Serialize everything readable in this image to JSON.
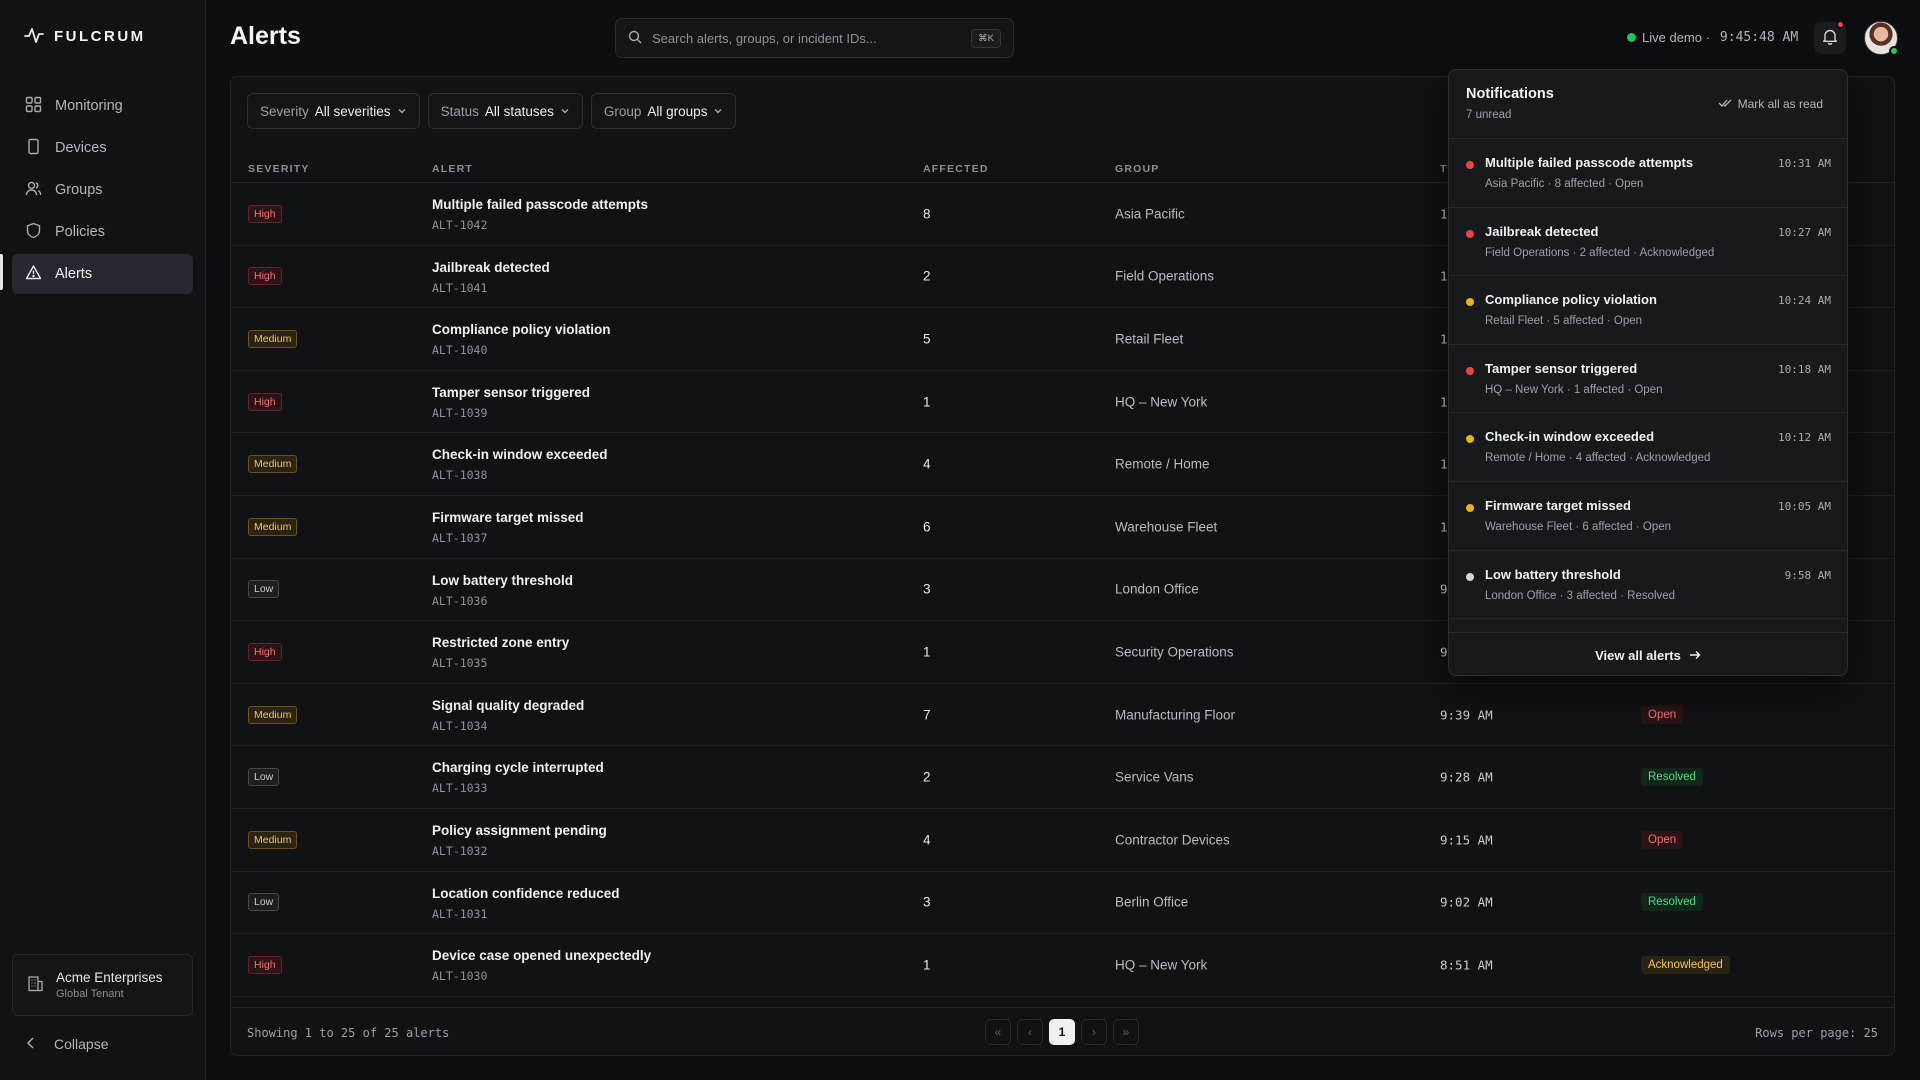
{
  "brand": "FULCRUM",
  "page_title": "Alerts",
  "sidebar": {
    "items": [
      {
        "label": "Monitoring",
        "icon": "grid-icon"
      },
      {
        "label": "Devices",
        "icon": "device-icon"
      },
      {
        "label": "Groups",
        "icon": "users-icon"
      },
      {
        "label": "Policies",
        "icon": "shield-icon"
      },
      {
        "label": "Alerts",
        "icon": "alert-triangle-icon",
        "active": true
      }
    ],
    "tenant": {
      "name": "Acme Enterprises",
      "sub": "Global Tenant"
    },
    "collapse_label": "Collapse"
  },
  "search": {
    "placeholder": "Search alerts, groups, or incident IDs...",
    "shortcut": "⌘K"
  },
  "header": {
    "live_label": "Live demo ·",
    "clock": "9:45:48 AM"
  },
  "filters": [
    {
      "label": "Severity",
      "value": "All severities"
    },
    {
      "label": "Status",
      "value": "All statuses"
    },
    {
      "label": "Group",
      "value": "All groups"
    }
  ],
  "table": {
    "columns": [
      "Severity",
      "Alert",
      "Affected",
      "Group",
      "T"
    ],
    "rows": [
      {
        "severity": "High",
        "title": "Multiple failed passcode attempts",
        "id": "ALT-1042",
        "affected": "8",
        "group": "Asia Pacific",
        "time": "1",
        "status": ""
      },
      {
        "severity": "High",
        "title": "Jailbreak detected",
        "id": "ALT-1041",
        "affected": "2",
        "group": "Field Operations",
        "time": "1",
        "status": ""
      },
      {
        "severity": "Medium",
        "title": "Compliance policy violation",
        "id": "ALT-1040",
        "affected": "5",
        "group": "Retail Fleet",
        "time": "1",
        "status": ""
      },
      {
        "severity": "High",
        "title": "Tamper sensor triggered",
        "id": "ALT-1039",
        "affected": "1",
        "group": "HQ – New York",
        "time": "1",
        "status": ""
      },
      {
        "severity": "Medium",
        "title": "Check-in window exceeded",
        "id": "ALT-1038",
        "affected": "4",
        "group": "Remote / Home",
        "time": "1",
        "status": ""
      },
      {
        "severity": "Medium",
        "title": "Firmware target missed",
        "id": "ALT-1037",
        "affected": "6",
        "group": "Warehouse Fleet",
        "time": "1",
        "status": ""
      },
      {
        "severity": "Low",
        "title": "Low battery threshold",
        "id": "ALT-1036",
        "affected": "3",
        "group": "London Office",
        "time": "9",
        "status": ""
      },
      {
        "severity": "High",
        "title": "Restricted zone entry",
        "id": "ALT-1035",
        "affected": "1",
        "group": "Security Operations",
        "time": "9",
        "status": ""
      },
      {
        "severity": "Medium",
        "title": "Signal quality degraded",
        "id": "ALT-1034",
        "affected": "7",
        "group": "Manufacturing Floor",
        "time": "9:39 AM",
        "status": "Open"
      },
      {
        "severity": "Low",
        "title": "Charging cycle interrupted",
        "id": "ALT-1033",
        "affected": "2",
        "group": "Service Vans",
        "time": "9:28 AM",
        "status": "Resolved"
      },
      {
        "severity": "Medium",
        "title": "Policy assignment pending",
        "id": "ALT-1032",
        "affected": "4",
        "group": "Contractor Devices",
        "time": "9:15 AM",
        "status": "Open"
      },
      {
        "severity": "Low",
        "title": "Location confidence reduced",
        "id": "ALT-1031",
        "affected": "3",
        "group": "Berlin Office",
        "time": "9:02 AM",
        "status": "Resolved"
      },
      {
        "severity": "High",
        "title": "Device case opened unexpectedly",
        "id": "ALT-1030",
        "affected": "1",
        "group": "HQ – New York",
        "time": "8:51 AM",
        "status": "Acknowledged"
      }
    ]
  },
  "footer": {
    "showing": "Showing 1 to 25 of 25 alerts",
    "page": "1",
    "rows_per_page": "Rows per page: 25"
  },
  "notifications": {
    "title": "Notifications",
    "unread": "7 unread",
    "mark_all": "Mark all as read",
    "view_all": "View all alerts",
    "items": [
      {
        "title": "Multiple failed passcode attempts",
        "sub": "Asia Pacific · 8 affected · Open",
        "time": "10:31 AM",
        "color": "#ef4444"
      },
      {
        "title": "Jailbreak detected",
        "sub": "Field Operations · 2 affected · Acknowledged",
        "time": "10:27 AM",
        "color": "#ef4444"
      },
      {
        "title": "Compliance policy violation",
        "sub": "Retail Fleet · 5 affected · Open",
        "time": "10:24 AM",
        "color": "#eab308"
      },
      {
        "title": "Tamper sensor triggered",
        "sub": "HQ – New York · 1 affected · Open",
        "time": "10:18 AM",
        "color": "#ef4444"
      },
      {
        "title": "Check-in window exceeded",
        "sub": "Remote / Home · 4 affected · Acknowledged",
        "time": "10:12 AM",
        "color": "#eab308"
      },
      {
        "title": "Firmware target missed",
        "sub": "Warehouse Fleet · 6 affected · Open",
        "time": "10:05 AM",
        "color": "#eab308"
      },
      {
        "title": "Low battery threshold",
        "sub": "London Office · 3 affected · Resolved",
        "time": "9:58 AM",
        "color": "#d4d4d8"
      }
    ]
  },
  "colors": {
    "accent": "#22c55e",
    "high": "#f87171",
    "medium": "#f5c451",
    "resolved": "#4ade80"
  }
}
